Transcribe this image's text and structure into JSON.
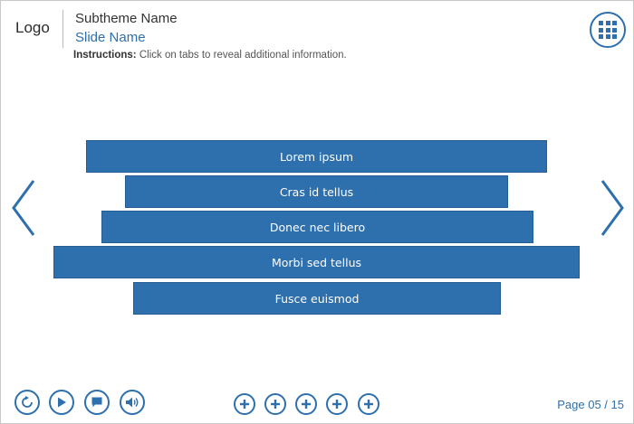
{
  "header": {
    "logo": "Logo",
    "subtheme": "Subtheme Name",
    "slide_name": "Slide Name",
    "instructions_label": "Instructions:",
    "instructions_text": " Click on tabs to reveal additional information."
  },
  "tabs": [
    {
      "label": "Lorem ipsum"
    },
    {
      "label": "Cras id tellus"
    },
    {
      "label": "Donec nec libero"
    },
    {
      "label": "Morbi sed tellus"
    },
    {
      "label": "Fusce euismod"
    }
  ],
  "footer": {
    "page_label": "Page 05 / 15",
    "controls": [
      "replay-icon",
      "play-icon",
      "chat-icon",
      "volume-icon"
    ],
    "plus_buttons_count": 5
  },
  "colors": {
    "accent": "#2e6fad",
    "tab_background": "#2e6fad",
    "text_dark": "#333333"
  }
}
